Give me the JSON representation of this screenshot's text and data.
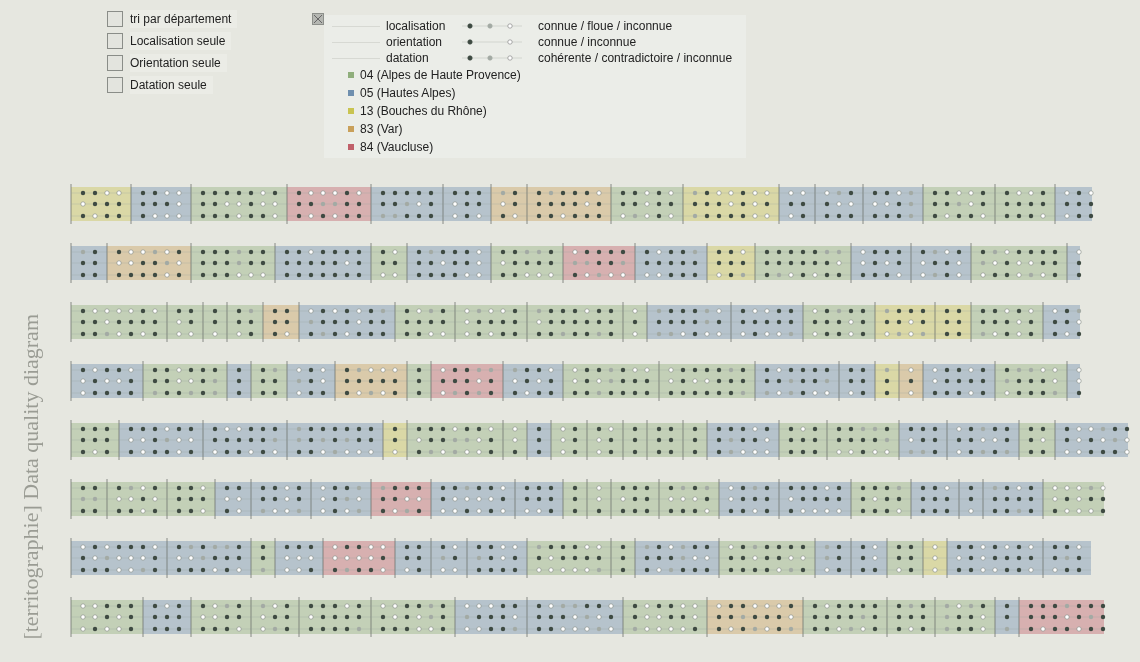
{
  "options": [
    {
      "label": "tri par département",
      "checked": false
    },
    {
      "label": "Localisation seule",
      "checked": false
    },
    {
      "label": "Orientation seule",
      "checked": false
    },
    {
      "label": "Datation seule",
      "checked": false
    }
  ],
  "legend": {
    "encodings": [
      {
        "label": "localisation",
        "kind": "ternary",
        "meaning": "connue / floue / inconnue"
      },
      {
        "label": "orientation",
        "kind": "binary",
        "meaning": "connue / inconnue"
      },
      {
        "label": "datation",
        "kind": "ternary",
        "meaning": "cohérente / contradictoire / inconnue"
      }
    ],
    "departments": [
      {
        "label": "04 (Alpes de Haute Provence)",
        "color": "#8fae7b"
      },
      {
        "label": "05 (Hautes Alpes)",
        "color": "#6f8fae"
      },
      {
        "label": "13 (Bouches du Rhône)",
        "color": "#c9c451"
      },
      {
        "label": "83 (Var)",
        "color": "#c9a05a"
      },
      {
        "label": "84 (Vaucluse)",
        "color": "#c0606a"
      }
    ]
  },
  "diagram_title": "[territographie] Data quality diagram"
}
